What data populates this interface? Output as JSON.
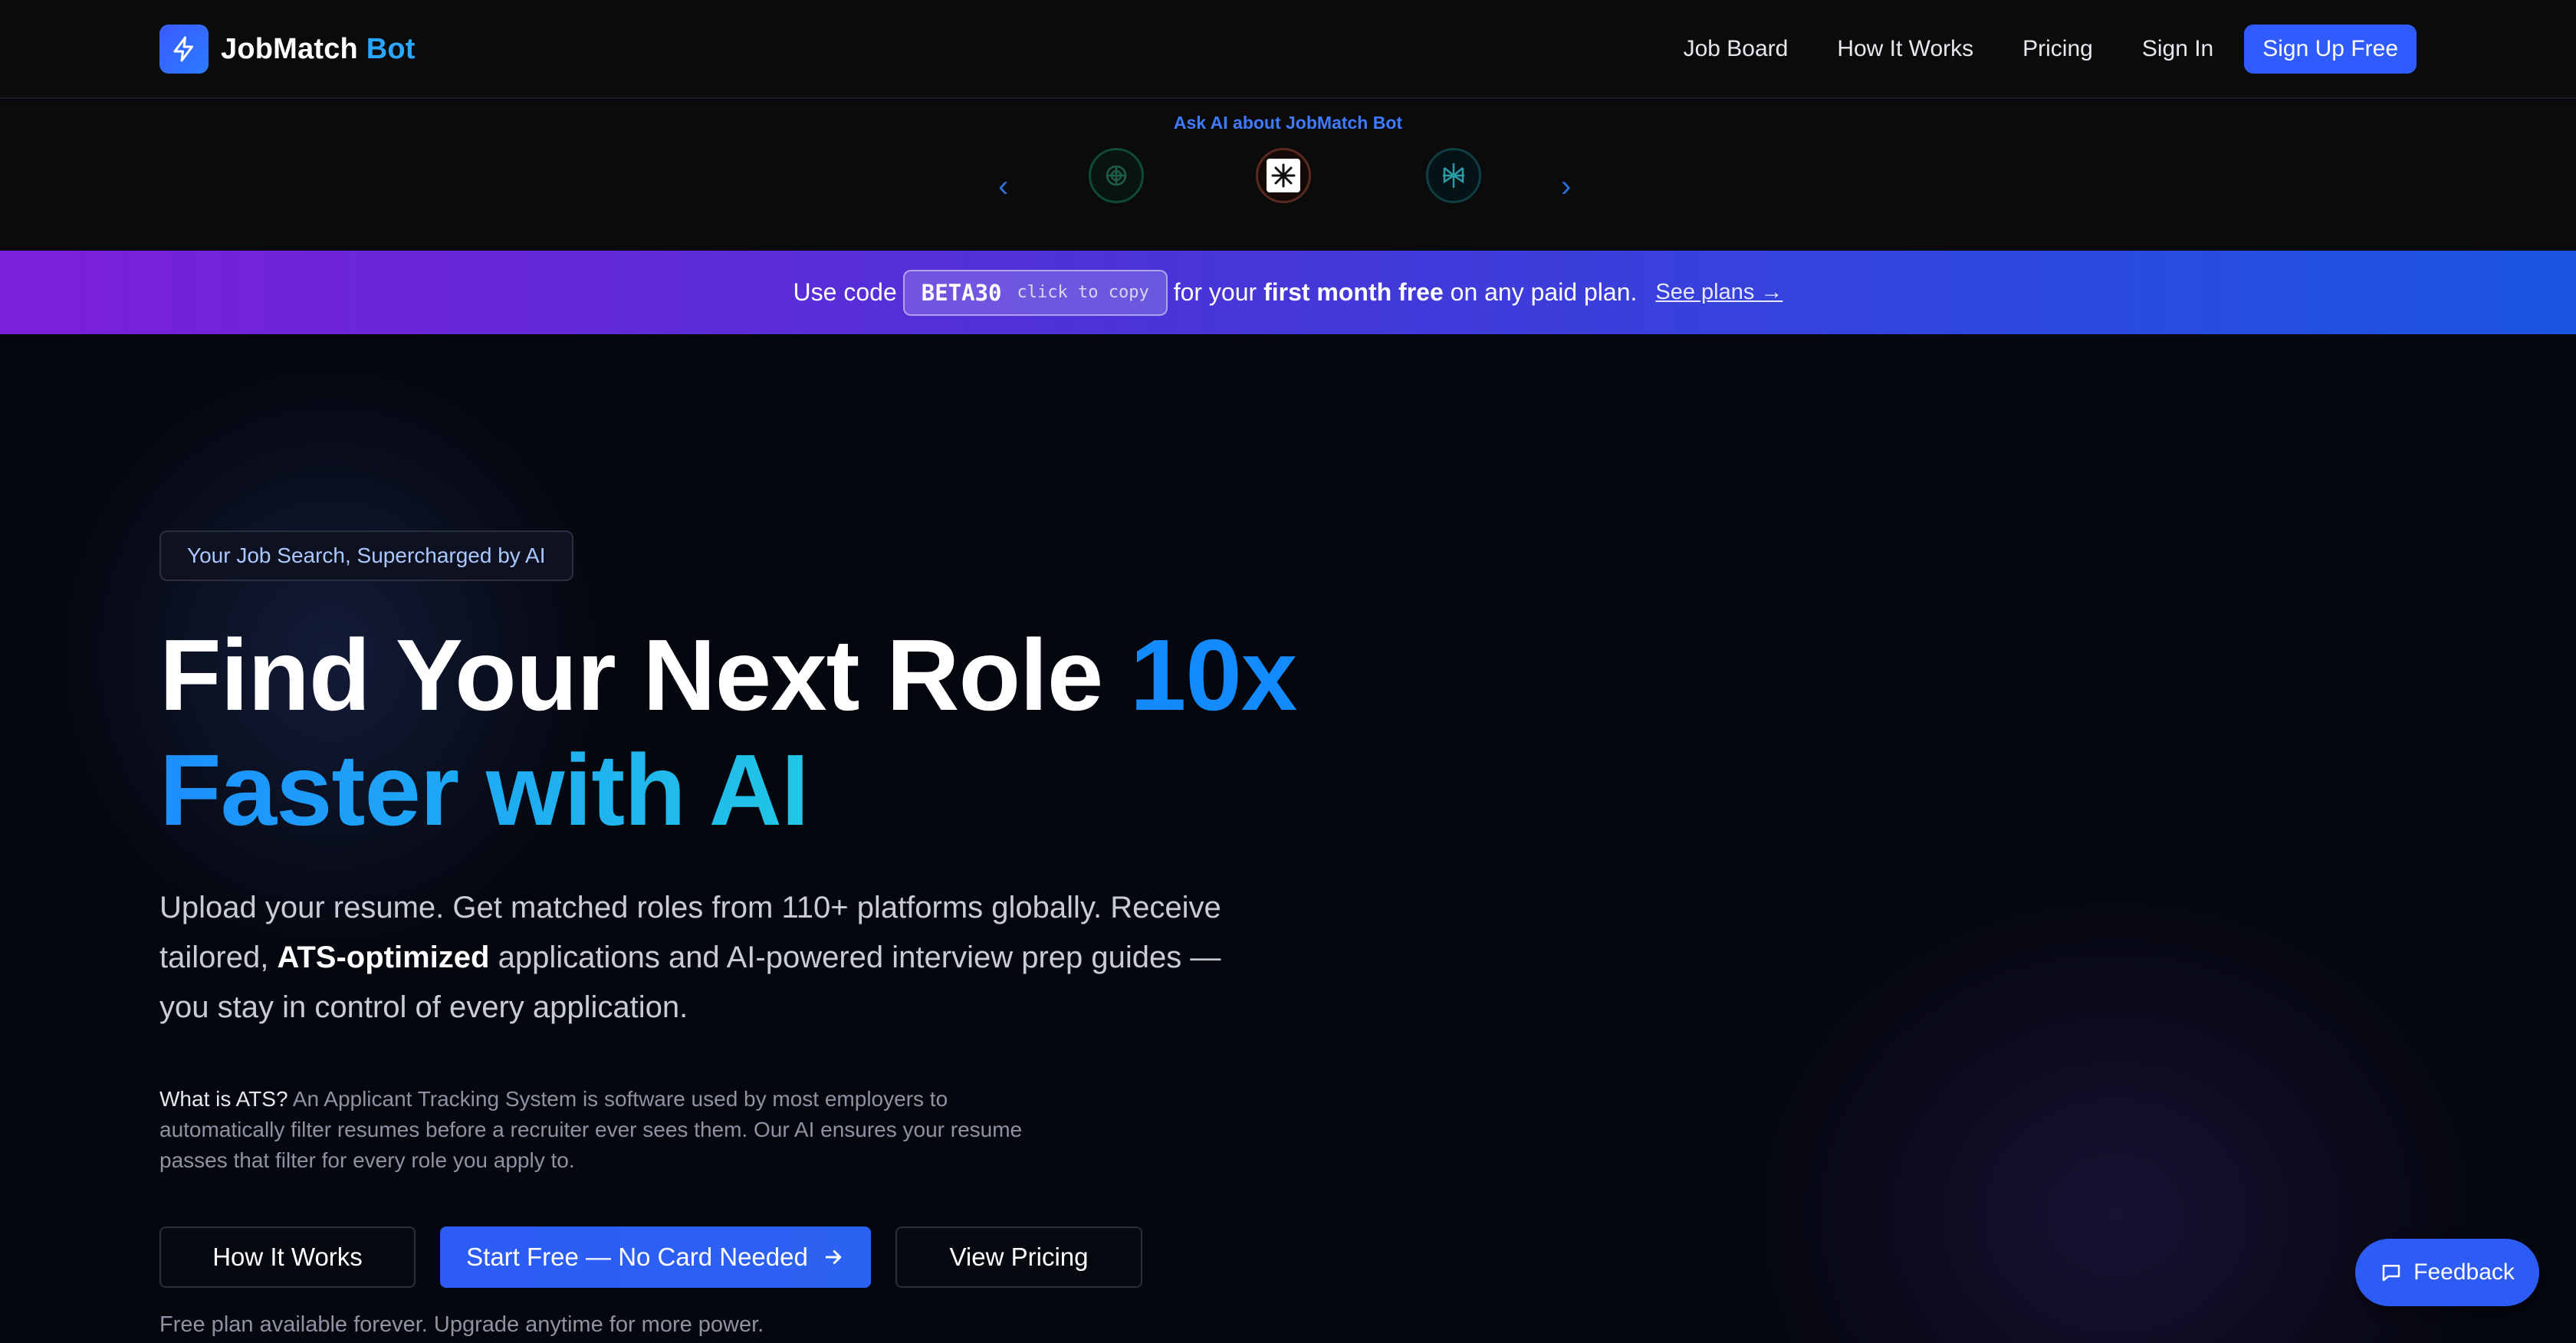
{
  "header": {
    "brand_main": "JobMatch",
    "brand_accent": "Bot",
    "nav": [
      "Job Board",
      "How It Works",
      "Pricing",
      "Sign In"
    ],
    "signup_label": "Sign Up Free"
  },
  "ai_strip": {
    "title": "Ask AI about JobMatch Bot",
    "icons": [
      "chatgpt-icon",
      "claude-icon",
      "perplexity-icon"
    ],
    "prev": "‹",
    "next": "›"
  },
  "promo": {
    "prefix": "Use code",
    "code": "BETA30",
    "copy_hint": "click to copy",
    "for_your": "for your",
    "bold": "first month free",
    "suffix": "on any paid plan.",
    "link": "See plans →"
  },
  "hero": {
    "badge": "Your Job Search, Supercharged by AI",
    "headline_white": "Find Your Next Role",
    "headline_blue": "10x",
    "headline_grad": "Faster with AI",
    "sub_1": "Upload your resume. Get matched roles from 110+ platforms globally. Receive tailored,",
    "sub_bold": "ATS-optimized",
    "sub_2": "applications and AI-powered interview prep guides — you stay in control of every application.",
    "ats_q": "What is ATS?",
    "ats_text": "An Applicant Tracking System is software used by most employers to automatically filter resumes before a recruiter ever sees them. Our AI ensures your resume passes that filter for every role you apply to.",
    "buttons": {
      "how": "How It Works",
      "start": "Start Free — No Card Needed",
      "pricing": "View Pricing"
    },
    "footnote": "Free plan available forever. Upgrade anytime for more power."
  },
  "feedback_label": "Feedback",
  "colors": {
    "accent_blue": "#2f5bff",
    "brand_cyan": "#2aa6ff",
    "promo_start": "#7c1fd8",
    "promo_end": "#1a55e0"
  }
}
